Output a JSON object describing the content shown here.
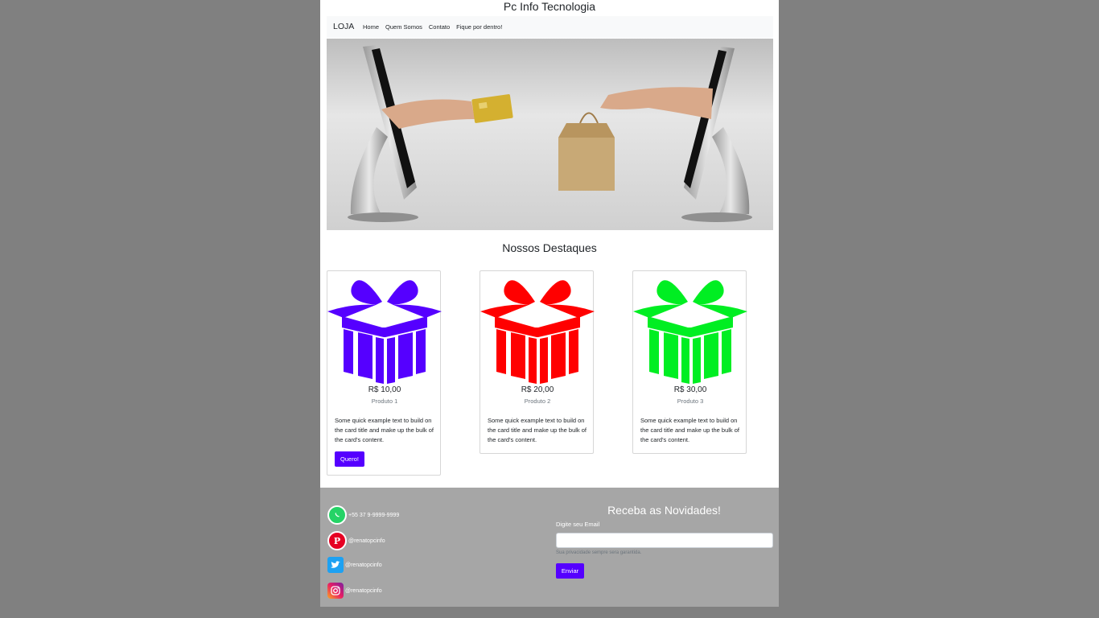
{
  "site": {
    "title": "Pc Info Tecnologia"
  },
  "navbar": {
    "brand": "LOJA",
    "links": [
      "Home",
      "Quem Somos",
      "Contato",
      "Fique por dentro!"
    ]
  },
  "featured": {
    "title": "Nossos Destaques",
    "products": [
      {
        "price": "R$ 10,00",
        "name": "Produto 1",
        "description": "Some quick example text to build on the card title and make up the bulk of the card's content.",
        "button": "Quero!",
        "color": "#5500ff"
      },
      {
        "price": "R$ 20,00",
        "name": "Produto 2",
        "description": "Some quick example text to build on the card title and make up the bulk of the card's content.",
        "color": "#ff0000"
      },
      {
        "price": "R$ 30,00",
        "name": "Produto 3",
        "description": "Some quick example text to build on the card title and make up the bulk of the card's content.",
        "color": "#00ee22"
      }
    ]
  },
  "footer": {
    "social": [
      {
        "icon": "whatsapp-icon",
        "text": "+55 37 9-9999-9999"
      },
      {
        "icon": "pinterest-icon",
        "text": "@renatopcinfo"
      },
      {
        "icon": "twitter-icon",
        "text": "@renatopcinfo"
      },
      {
        "icon": "instagram-icon",
        "text": "@renatopcinfo"
      }
    ],
    "newsletter": {
      "title": "Receba as Novidades!",
      "label": "Digite seu Email",
      "help": "Sua privacidade sempre sera garantida.",
      "button": "Enviar"
    }
  },
  "colors": {
    "accent": "#5500ff",
    "footer_bg": "#a6a6a6",
    "page_bg": "#808080"
  }
}
